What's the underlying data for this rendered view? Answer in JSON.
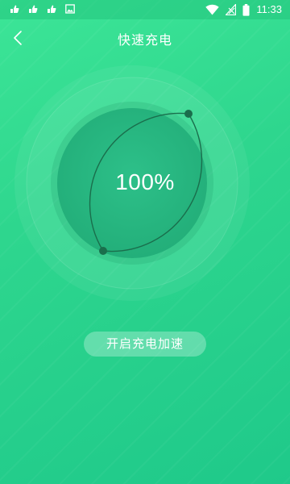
{
  "status_bar": {
    "time": "11:33",
    "notification_icons": [
      "app-notification-icon",
      "app-notification-icon",
      "app-notification-icon",
      "image-notification-icon"
    ],
    "system_icons": [
      "wifi-icon",
      "no-signal-icon",
      "battery-icon"
    ]
  },
  "header": {
    "title": "快速充电",
    "back_icon": "chevron-left-icon"
  },
  "charging": {
    "percent_label": "100%",
    "progress": 1.0
  },
  "actions": {
    "boost_label": "开启充电加速"
  },
  "colors": {
    "background_top": "#3ce597",
    "background_bottom": "#1fc98a",
    "dial_inner": "#27b57d",
    "arc_dark": "#1a6e4c"
  }
}
